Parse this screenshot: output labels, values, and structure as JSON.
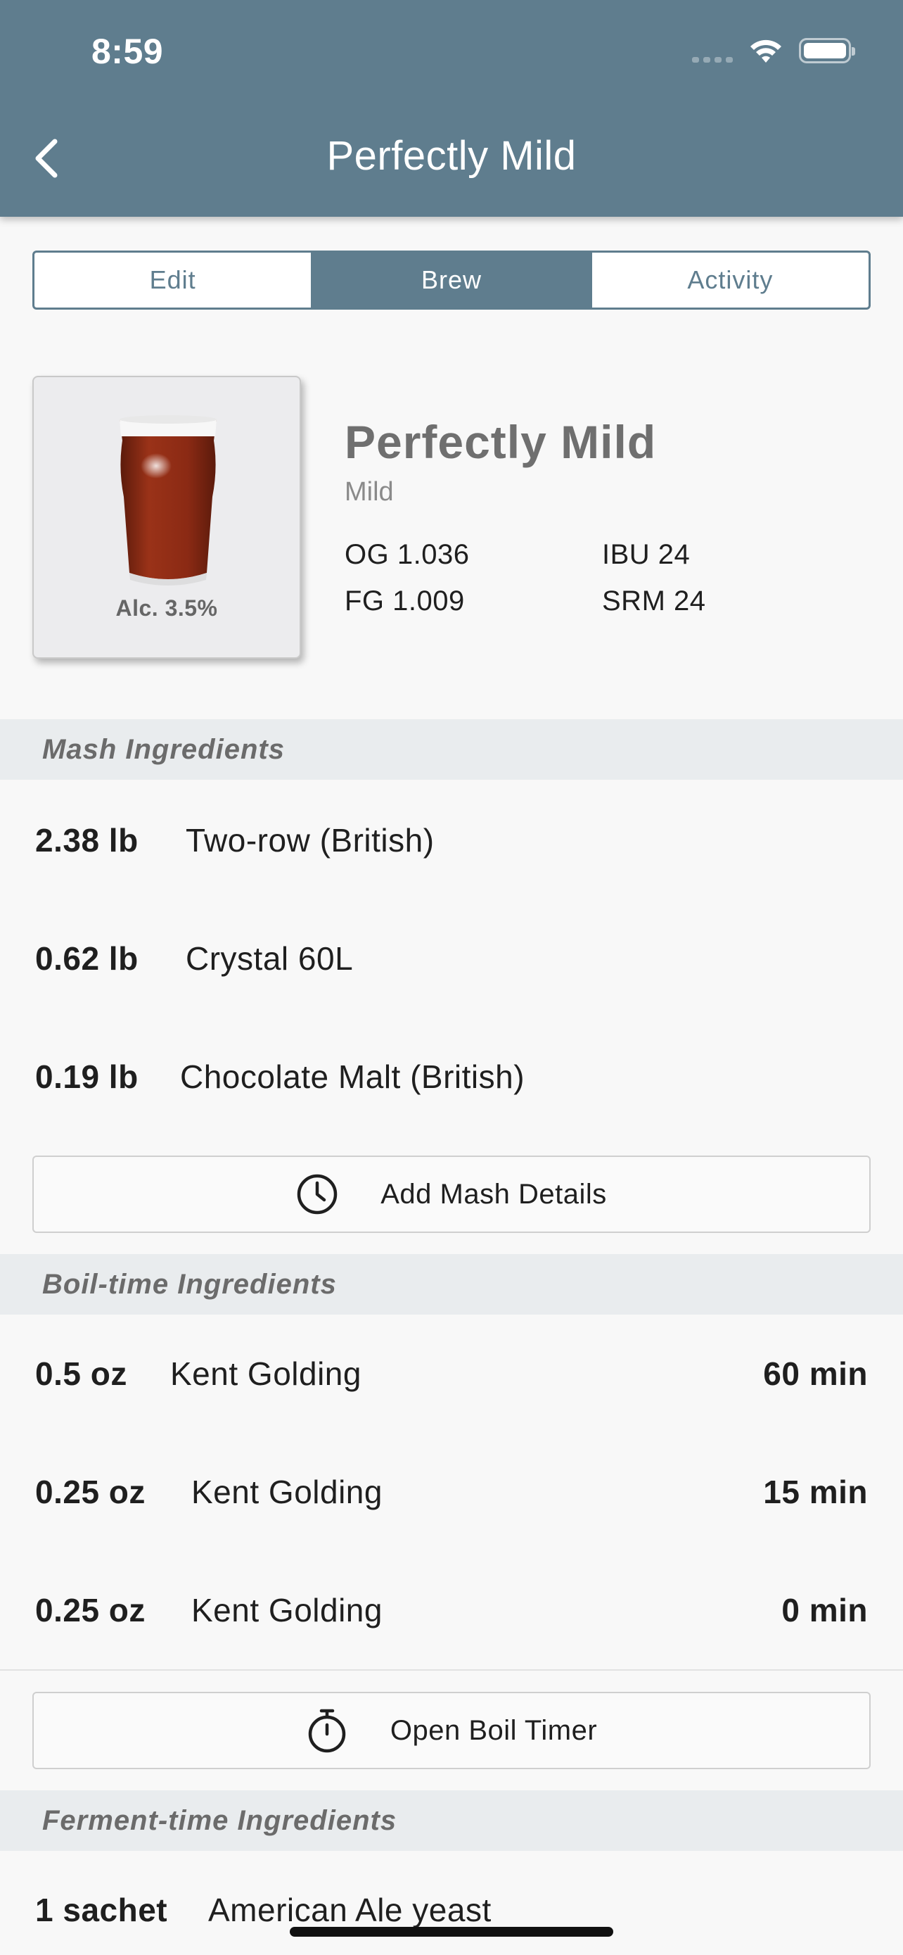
{
  "status_bar": {
    "time": "8:59"
  },
  "nav": {
    "title": "Perfectly Mild",
    "back_icon": "chevron-left-icon"
  },
  "tabs": [
    {
      "label": "Edit",
      "active": false
    },
    {
      "label": "Brew",
      "active": true
    },
    {
      "label": "Activity",
      "active": false
    }
  ],
  "recipe": {
    "name": "Perfectly Mild",
    "style": "Mild",
    "abv": "Alc. 3.5%",
    "og": "OG 1.036",
    "fg": "FG 1.009",
    "ibu": "IBU 24",
    "srm": "SRM 24",
    "glass_color": "#8b2a14"
  },
  "mash": {
    "header": "Mash Ingredients",
    "items": [
      {
        "amount": "2.38 lb",
        "name": "Two-row (British)"
      },
      {
        "amount": "0.62 lb",
        "name": "Crystal 60L"
      },
      {
        "amount": "0.19 lb",
        "name": "Chocolate Malt (British)"
      }
    ],
    "button_label": "Add Mash Details",
    "button_icon": "clock-icon"
  },
  "boil": {
    "header": "Boil-time Ingredients",
    "items": [
      {
        "amount": "0.5 oz",
        "name": "Kent Golding",
        "time": "60 min"
      },
      {
        "amount": "0.25 oz",
        "name": "Kent Golding",
        "time": "15 min"
      },
      {
        "amount": "0.25 oz",
        "name": "Kent Golding",
        "time": "0 min"
      }
    ],
    "button_label": "Open Boil Timer",
    "button_icon": "stopwatch-icon"
  },
  "ferment": {
    "header": "Ferment-time Ingredients",
    "items": [
      {
        "amount": "1 sachet",
        "name": "American Ale yeast"
      }
    ]
  },
  "colors": {
    "accent": "#5f7d8e",
    "section_bg": "#e9ecee"
  }
}
